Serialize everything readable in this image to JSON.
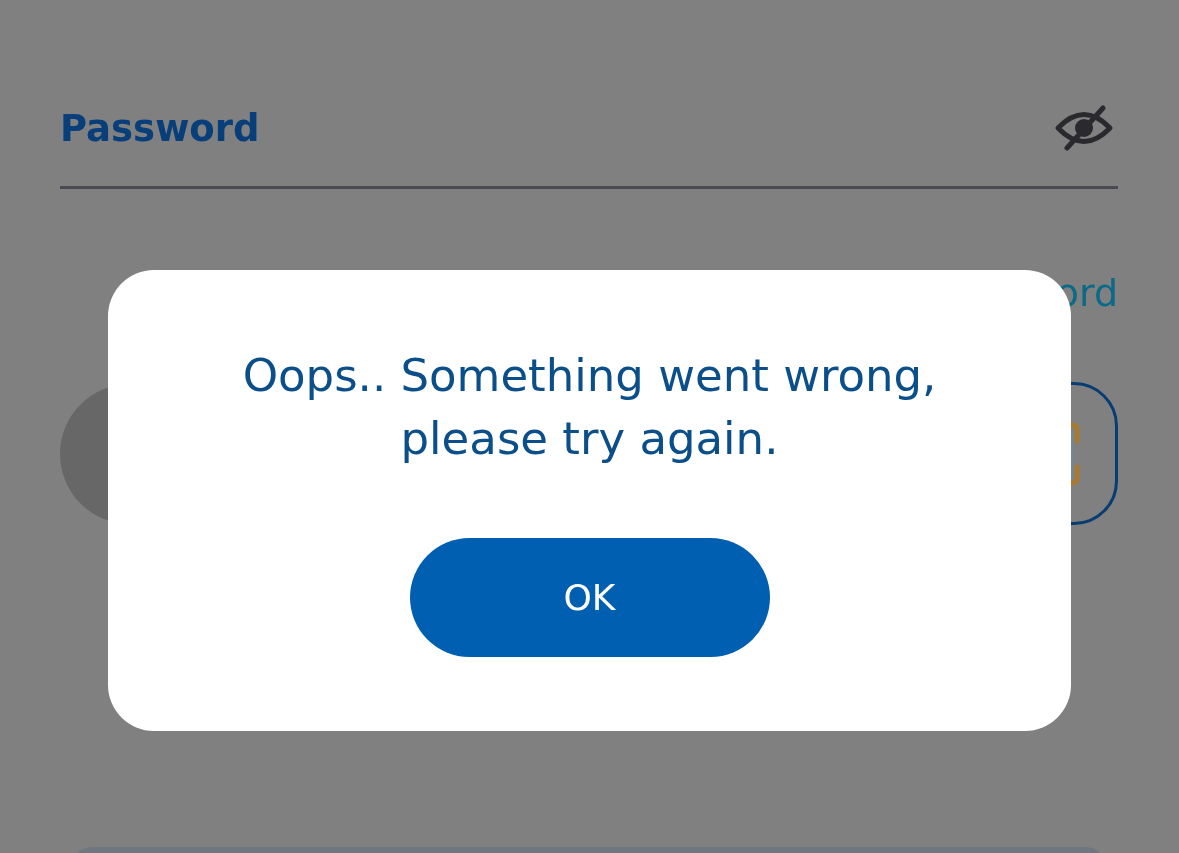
{
  "password_field": {
    "placeholder": "Password",
    "password_visible": false
  },
  "forgot_link": {
    "text": "ord"
  },
  "dialog": {
    "message": "Oops.. Something went wrong, please try again.",
    "buttons": [
      "OK"
    ]
  }
}
